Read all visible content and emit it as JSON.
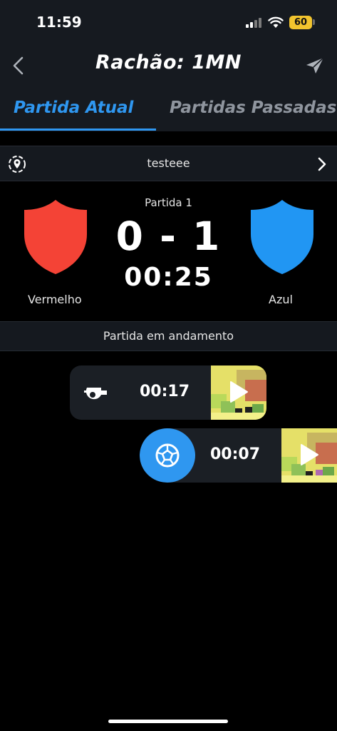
{
  "status_bar": {
    "time": "11:59",
    "battery": "60"
  },
  "header": {
    "title": "Rachão: 1MN"
  },
  "tabs": [
    {
      "label": "Partida Atual",
      "active": true
    },
    {
      "label": "Partidas Passadas",
      "active": false
    }
  ],
  "location": {
    "name": "testeee"
  },
  "match": {
    "label": "Partida 1",
    "score": "0 - 1",
    "clock": "00:25",
    "home_team": {
      "name": "Vermelho",
      "color": "#f44336"
    },
    "away_team": {
      "name": "Azul",
      "color": "#2196f3"
    }
  },
  "match_state": "Partida em andamento",
  "events": [
    {
      "icon": "whistle-icon",
      "time": "00:17"
    },
    {
      "icon": "soccer-ball-icon",
      "time": "00:07"
    }
  ],
  "colors": {
    "accent": "#2f97f0",
    "background": "#000000",
    "panel": "#15191f"
  }
}
